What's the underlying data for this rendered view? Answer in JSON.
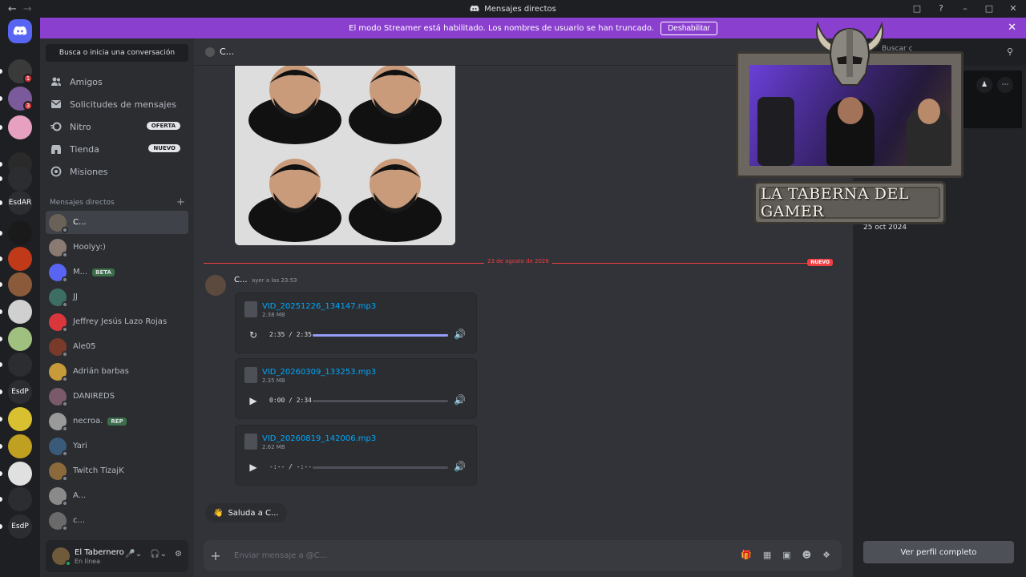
{
  "window": {
    "title": "Mensajes directos"
  },
  "banner": {
    "text": "El modo Streamer está habilitado. Los nombres de usuario se han truncado.",
    "button": "Deshabilitar"
  },
  "servers": [
    {
      "label": "",
      "badge": ""
    },
    {
      "label": "",
      "badge": "1"
    },
    {
      "label": "",
      "badge": "3"
    },
    {
      "label": "",
      "badge": ""
    },
    {
      "label": "",
      "badge": ""
    },
    {
      "label": "",
      "badge": ""
    },
    {
      "label": "EsdAR",
      "badge": ""
    },
    {
      "label": "",
      "badge": ""
    },
    {
      "label": "",
      "badge": ""
    },
    {
      "label": "",
      "badge": ""
    },
    {
      "label": "",
      "badge": ""
    },
    {
      "label": "",
      "badge": ""
    },
    {
      "label": "",
      "badge": ""
    },
    {
      "label": "EsdP",
      "badge": ""
    },
    {
      "label": "",
      "badge": ""
    },
    {
      "label": "",
      "badge": ""
    },
    {
      "label": "",
      "badge": ""
    },
    {
      "label": "",
      "badge": ""
    },
    {
      "label": "EsdP",
      "badge": ""
    }
  ],
  "sidebar": {
    "search": "Busca o inicia una conversación",
    "nav": [
      {
        "label": "Amigos",
        "tag": ""
      },
      {
        "label": "Solicitudes de mensajes",
        "tag": ""
      },
      {
        "label": "Nitro",
        "tag": "OFERTA"
      },
      {
        "label": "Tienda",
        "tag": "NUEVO"
      },
      {
        "label": "Misiones",
        "tag": ""
      }
    ],
    "dm_heading": "Mensajes directos",
    "dms": [
      {
        "name": "C...",
        "badge": "",
        "color": "#6b6257"
      },
      {
        "name": "Hoolyy:)",
        "badge": "",
        "color": "#8a7a72"
      },
      {
        "name": "M...",
        "badge": "BETA",
        "color": "#5865f2"
      },
      {
        "name": "JJ",
        "badge": "",
        "color": "#3d6e64"
      },
      {
        "name": "Jeffrey Jesús Lazo Rojas",
        "badge": "",
        "color": "#da373c"
      },
      {
        "name": "Ale05",
        "badge": "",
        "color": "#7a3a2a"
      },
      {
        "name": "Adrián barbas",
        "badge": "",
        "color": "#c79a3a"
      },
      {
        "name": "DANIREDS",
        "badge": "",
        "color": "#7a5a6a"
      },
      {
        "name": "necroa.",
        "badge": "REP",
        "color": "#9a9a9a"
      },
      {
        "name": "Yari",
        "badge": "",
        "color": "#3a5a7a"
      },
      {
        "name": "Twitch TizajK",
        "badge": "",
        "color": "#8a6a3a"
      },
      {
        "name": "A...",
        "badge": "",
        "color": "#8a8a8a"
      },
      {
        "name": "c...",
        "badge": "",
        "color": "#6a6a6a"
      }
    ],
    "user": {
      "name": "El Tabernero",
      "status": "En línea"
    }
  },
  "chat": {
    "header_name": "C...",
    "date_divider": "23 de agosto de 2026",
    "new_label": "NUEVO",
    "author": "C...",
    "timestamp": "ayer a las 23:53",
    "attachments": [
      {
        "file": "VID_20251226_134147.mp3",
        "size": "2.38 MB",
        "time": "2:35 / 2:35",
        "progress": 1.0,
        "state": "replay"
      },
      {
        "file": "VID_20260309_133253.mp3",
        "size": "2.35 MB",
        "time": "0:00 / 2:34",
        "progress": 0.0,
        "state": "play"
      },
      {
        "file": "VID_20260819_142006.mp3",
        "size": "2.62 MB",
        "time": "-:-- / -:--",
        "progress": 0.0,
        "state": "play"
      }
    ],
    "wave_prompt": "Saluda a C...",
    "composer_placeholder": "Enviar mensaje a @C...",
    "search_placeholder": "Buscar c"
  },
  "profile": {
    "member_since": "25 oct 2024",
    "view_full": "Ver perfil completo"
  },
  "overlay": {
    "plaque_text": "LA TABERNA DEL GAMER"
  }
}
